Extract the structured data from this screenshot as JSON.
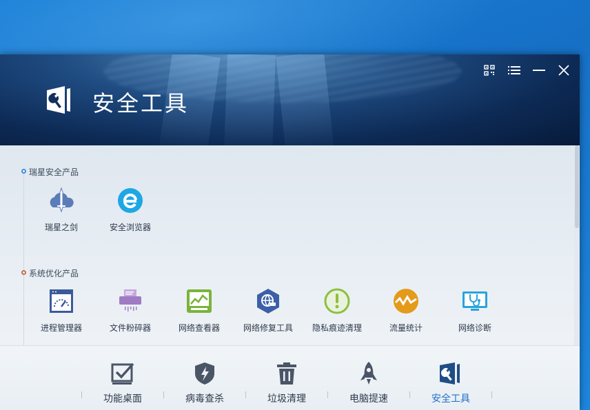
{
  "window": {
    "title": "安全工具"
  },
  "controls": {
    "qr_icon": "qrcode-icon",
    "menu_icon": "menu-icon",
    "minimize_icon": "minimize-icon",
    "close_icon": "close-icon"
  },
  "sections": [
    {
      "label": "瑞星安全产品",
      "items": [
        {
          "label": "瑞星之剑",
          "icon": "sword-cloud-icon",
          "color": "#5b7cb8"
        },
        {
          "label": "安全浏览器",
          "icon": "browser-e-icon",
          "color": "#1ea7e4"
        }
      ]
    },
    {
      "label": "系统优化产品",
      "items": [
        {
          "label": "进程管理器",
          "icon": "process-gauge-icon",
          "color": "#3a5a99"
        },
        {
          "label": "文件粉碎器",
          "icon": "shredder-icon",
          "color": "#a07bc4"
        },
        {
          "label": "网络查看器",
          "icon": "network-monitor-icon",
          "color": "#7ab33a"
        },
        {
          "label": "网络修复工具",
          "icon": "globe-repair-icon",
          "color": "#3d5fa8"
        },
        {
          "label": "隐私痕迹清理",
          "icon": "privacy-alert-icon",
          "color": "#8cbf3f"
        },
        {
          "label": "流量统计",
          "icon": "traffic-chart-icon",
          "color": "#e49a1a"
        },
        {
          "label": "网络诊断",
          "icon": "network-diagnose-icon",
          "color": "#2aa3dd"
        }
      ]
    }
  ],
  "bottom_nav": [
    {
      "label": "功能桌面",
      "icon": "checkbox-desktop-icon"
    },
    {
      "label": "病毒查杀",
      "icon": "shield-virus-icon"
    },
    {
      "label": "垃圾清理",
      "icon": "trash-icon"
    },
    {
      "label": "电脑提速",
      "icon": "rocket-icon"
    },
    {
      "label": "安全工具",
      "icon": "security-tools-icon",
      "active": true
    }
  ]
}
